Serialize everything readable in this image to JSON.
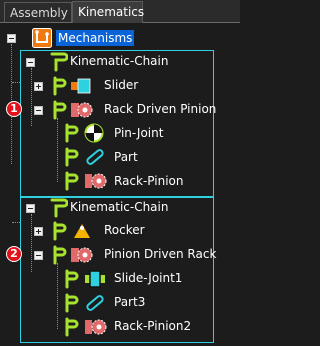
{
  "tabs": [
    {
      "label": "Assembly",
      "active": false
    },
    {
      "label": "Kinematics",
      "active": true
    }
  ],
  "tree": {
    "root": {
      "label": "Mechanisms",
      "selected": true
    },
    "chains": [
      {
        "label": "Kinematic-Chain",
        "badge": "1",
        "children": [
          {
            "label": "Slider",
            "icon": "slider-icon",
            "expanded": false
          },
          {
            "label": "Rack Driven Pinion",
            "icon": "pinion-gear-icon",
            "expanded": true,
            "joints": [
              {
                "label": "Pin-Joint",
                "icon": "pin-joint-icon"
              },
              {
                "label": "Part",
                "icon": "part-link-icon"
              },
              {
                "label": "Rack-Pinion",
                "icon": "rack-pinion-icon"
              }
            ]
          }
        ]
      },
      {
        "label": "Kinematic-Chain",
        "badge": "2",
        "children": [
          {
            "label": "Rocker",
            "icon": "rocker-icon",
            "expanded": false
          },
          {
            "label": "Pinion Driven Rack",
            "icon": "pinion-gear-icon",
            "expanded": true,
            "joints": [
              {
                "label": "Slide-Joint1",
                "icon": "slide-joint-icon"
              },
              {
                "label": "Part3",
                "icon": "part-link-icon"
              },
              {
                "label": "Rack-Pinion2",
                "icon": "rack-pinion-icon"
              }
            ]
          }
        ]
      }
    ]
  },
  "colors": {
    "accent_cyan": "#2fd0e0",
    "icon_green": "#a6e22e",
    "gear_pink": "#e06a6a",
    "badge_red": "#e3121a",
    "selection_blue": "#0a64d8",
    "root_icon_orange": "#f07a10"
  }
}
